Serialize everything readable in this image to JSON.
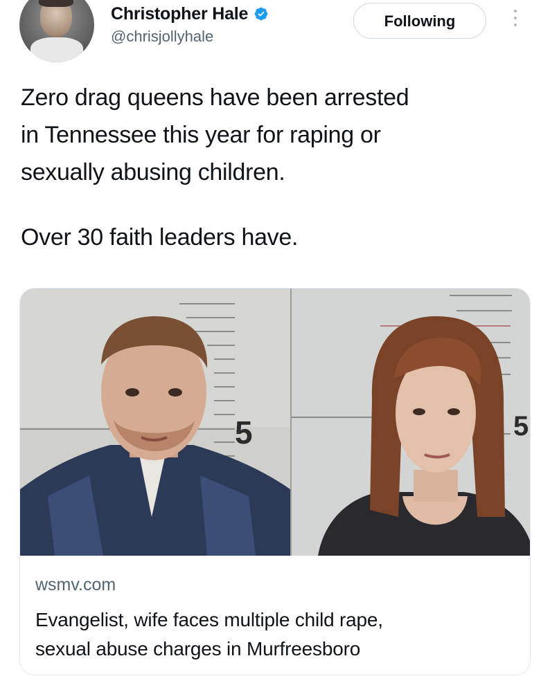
{
  "author": {
    "display_name": "Christopher Hale",
    "handle": "@chrisjollyhale",
    "verified_icon": "verified-badge-icon",
    "verified_color": "#1d9bf0"
  },
  "follow_button": {
    "label": "Following"
  },
  "more_menu": {
    "icon": "more-vertical-icon"
  },
  "tweet": {
    "line_1": "Zero drag queens have been arrested",
    "line_2": "in Tennessee this year for raping or",
    "line_3": "sexually abusing children.",
    "line_4": "Over 30 faith leaders have."
  },
  "link_card": {
    "domain": "wsmv.com",
    "title_line_1": "Evangelist, wife faces multiple child rape,",
    "title_line_2": "sexual abuse charges in Murfreesboro",
    "image": {
      "left_sign_number": "5",
      "right_sign_number": "5"
    }
  },
  "colors": {
    "text_primary": "#0f1419",
    "text_secondary": "#536471",
    "border": "#e1e8ed"
  }
}
